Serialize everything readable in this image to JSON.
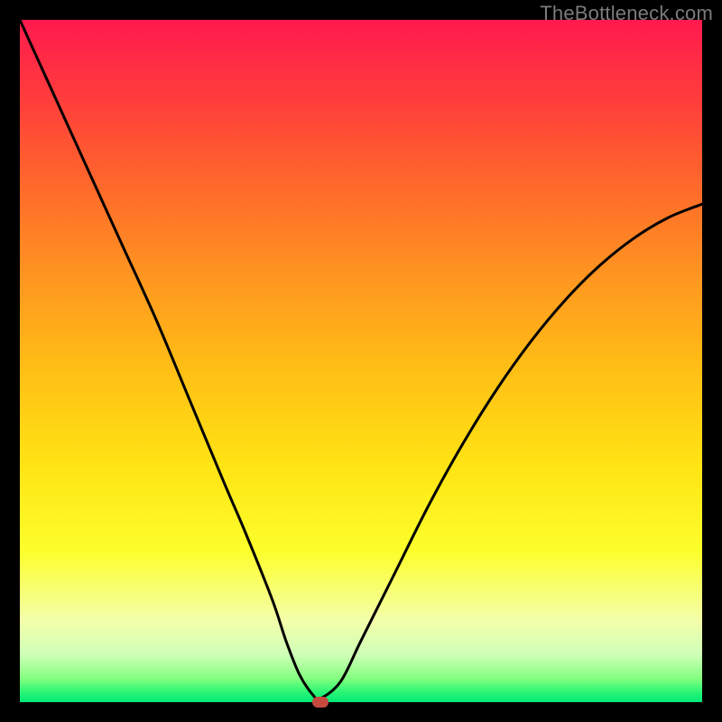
{
  "watermark": {
    "text": "TheBottleneck.com"
  },
  "chart_data": {
    "type": "line",
    "title": "",
    "xlabel": "",
    "ylabel": "",
    "xlim": [
      0,
      100
    ],
    "ylim": [
      0,
      100
    ],
    "grid": false,
    "legend": false,
    "series": [
      {
        "name": "curve",
        "x": [
          0,
          5,
          10,
          15,
          20,
          25,
          30,
          33,
          37,
          39,
          41,
          43,
          44,
          47,
          50,
          55,
          60,
          65,
          70,
          75,
          80,
          85,
          90,
          95,
          100
        ],
        "y": [
          100,
          89,
          78,
          67,
          56,
          44,
          32,
          25,
          15,
          9,
          4,
          1,
          0.5,
          3,
          9,
          19,
          29,
          38,
          46,
          53,
          59,
          64,
          68,
          71,
          73
        ]
      }
    ],
    "marker": {
      "x": 44,
      "y": 0,
      "color": "#c74a3f"
    },
    "background_gradient": {
      "type": "vertical",
      "stops": [
        {
          "pos": 0.0,
          "color": "#ff1a4e"
        },
        {
          "pos": 0.12,
          "color": "#ff3e3b"
        },
        {
          "pos": 0.25,
          "color": "#ff6b2a"
        },
        {
          "pos": 0.38,
          "color": "#ff9720"
        },
        {
          "pos": 0.5,
          "color": "#ffbb16"
        },
        {
          "pos": 0.65,
          "color": "#ffe313"
        },
        {
          "pos": 0.78,
          "color": "#fcff2c"
        },
        {
          "pos": 0.88,
          "color": "#f3ffaa"
        },
        {
          "pos": 0.93,
          "color": "#cfffb8"
        },
        {
          "pos": 0.965,
          "color": "#85ff80"
        },
        {
          "pos": 0.985,
          "color": "#2cf574"
        },
        {
          "pos": 1.0,
          "color": "#00e97a"
        }
      ]
    }
  }
}
